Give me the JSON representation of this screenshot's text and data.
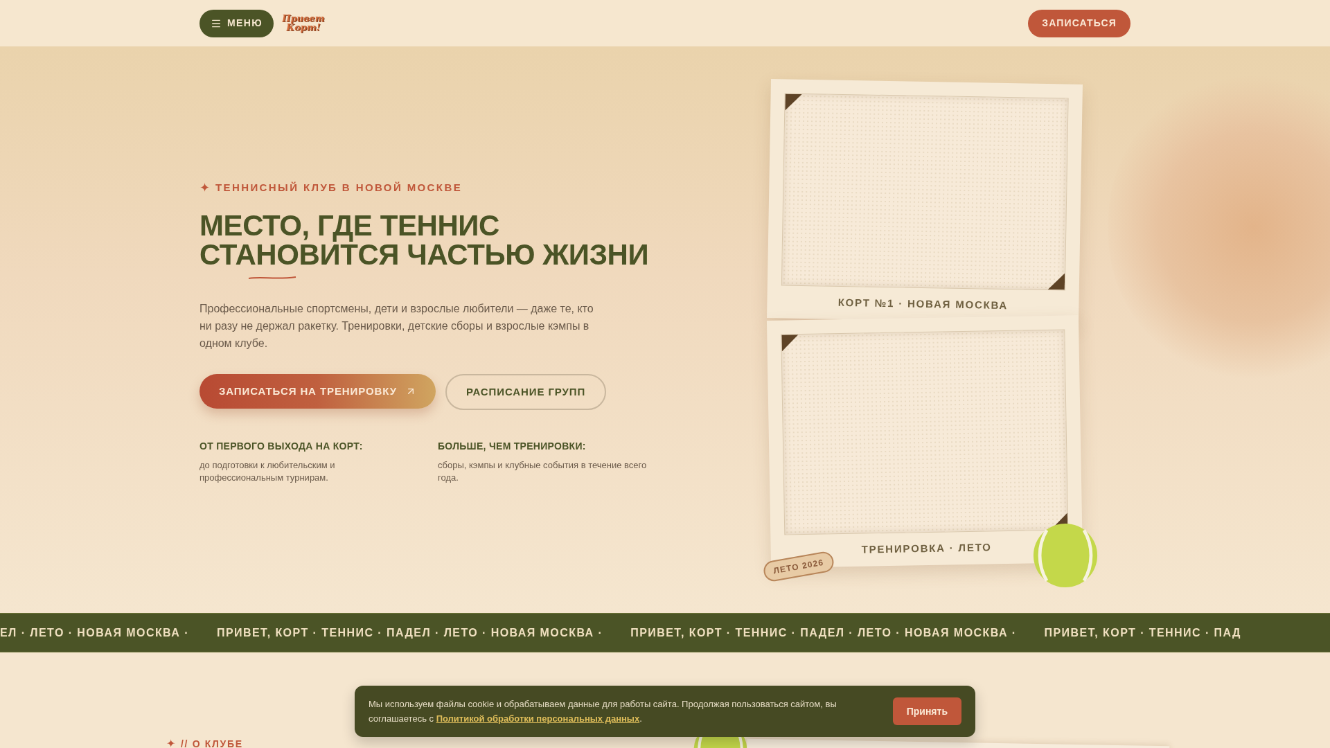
{
  "header": {
    "menu_label": "МЕНЮ",
    "logo": [
      "Привет",
      "Корт!"
    ],
    "cta": "ЗАПИСАТЬСЯ"
  },
  "hero": {
    "eyebrow_icon": "✦",
    "eyebrow": "ТЕННИСНЫЙ КЛУБ В НОВОЙ МОСКВЕ",
    "title_lines": [
      "МЕСТО, ГДЕ ТЕННИС",
      "СТАНОВИТСЯ ЧАСТЬЮ ЖИЗНИ"
    ],
    "description": "Профессиональные спортсмены, дети и взрослые любители — даже те, кто ни разу не держал ракетку. Тренировки, детские сборы и взрослые кэмпы в одном клубе.",
    "primary_button": "ЗАПИСАТЬСЯ НА ТРЕНИРОВКУ",
    "secondary_button": "РАСПИСАНИЕ ГРУПП",
    "features": [
      {
        "title": "ОТ ПЕРВОГО ВЫХОДА НА КОРТ:",
        "text": "до подготовки к любительским и профессиональным турнирам."
      },
      {
        "title": "БОЛЬШЕ, ЧЕМ ТРЕНИРОВКИ:",
        "text": "сборы, кэмпы и клубные события в течение всего года."
      }
    ]
  },
  "photos": [
    {
      "caption": "КОРТ №1 · НОВАЯ МОСКВА"
    },
    {
      "caption": "ТРЕНИРОВКА · ЛЕТО"
    }
  ],
  "badge": "ЛЕТО 2026",
  "marquee": [
    "ЕЛ · ЛЕТО · НОВАЯ МОСКВА ·",
    "ПРИВЕТ, КОРТ · ТЕННИС · ПАДЕЛ · ЛЕТО · НОВАЯ МОСКВА ·",
    "ПРИВЕТ, КОРТ · ТЕННИС · ПАДЕЛ · ЛЕТО · НОВАЯ МОСКВА ·",
    "ПРИВЕТ, КОРТ · ТЕННИС · ПАД"
  ],
  "about": {
    "eyebrow_icon": "✦",
    "label": "// О КЛУБЕ"
  },
  "cookie": {
    "text": "Мы используем файлы cookie и обрабатываем данные для работы сайта. Продолжая пользоваться сайтом, вы соглашаетесь с ",
    "link": "Политикой обработки персональных данных",
    "tail": ".",
    "button": "Принять"
  }
}
